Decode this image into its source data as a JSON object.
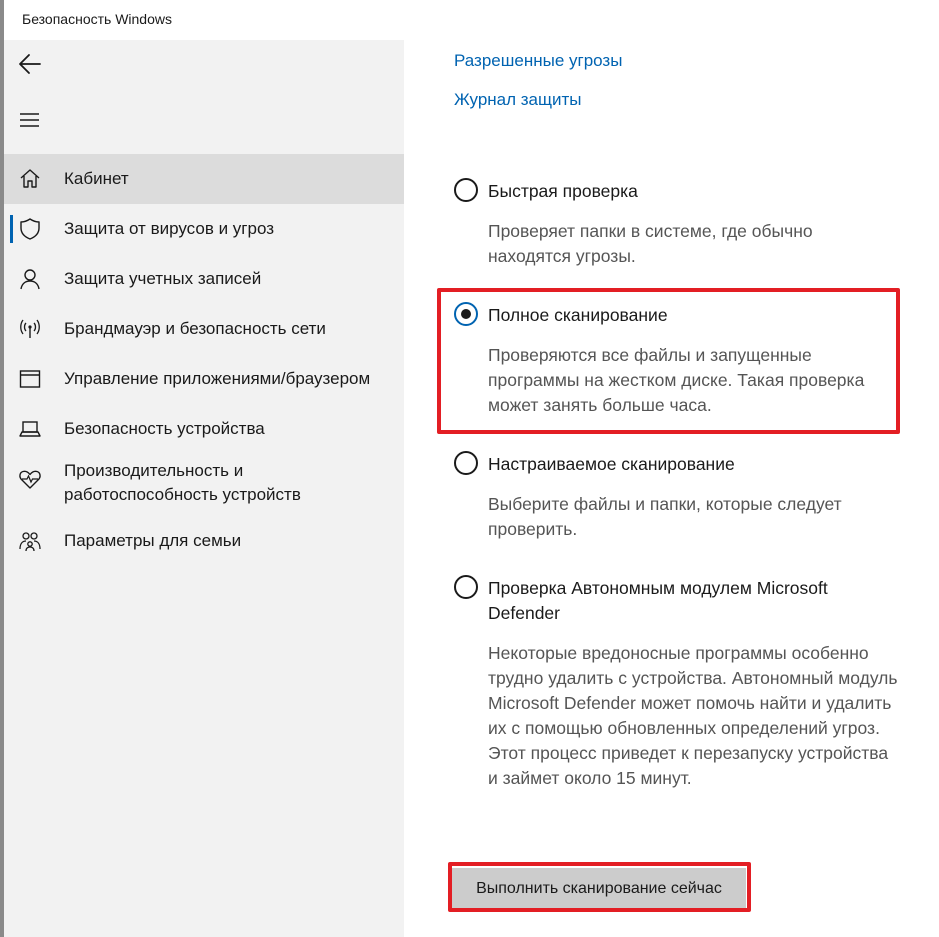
{
  "window": {
    "title": "Безопасность Windows"
  },
  "sidebar": {
    "back_icon": "back-arrow-icon",
    "menu_icon": "hamburger-menu-icon",
    "items": [
      {
        "label": "Кабинет",
        "icon": "home-icon",
        "active": true
      },
      {
        "label": "Защита от вирусов и угроз",
        "icon": "shield-icon",
        "selected_indicator": true
      },
      {
        "label": "Защита учетных записей",
        "icon": "person-icon"
      },
      {
        "label": "Брандмауэр и безопасность сети",
        "icon": "wifi-antenna-icon"
      },
      {
        "label": "Управление приложениями/браузером",
        "icon": "browser-window-icon"
      },
      {
        "label": "Безопасность устройства",
        "icon": "laptop-icon"
      },
      {
        "label": "Производительность и работоспособность устройств",
        "icon": "heart-pulse-icon"
      },
      {
        "label": "Параметры для семьи",
        "icon": "family-icon"
      }
    ]
  },
  "main": {
    "links": [
      {
        "label": "Разрешенные угрозы"
      },
      {
        "label": "Журнал защиты"
      }
    ],
    "options": [
      {
        "title": "Быстрая проверка",
        "description": "Проверяет папки в системе, где обычно находятся угрозы.",
        "checked": false
      },
      {
        "title": "Полное сканирование",
        "description": "Проверяются все файлы и запущенные программы на жестком диске. Такая проверка может занять больше часа.",
        "checked": true
      },
      {
        "title": "Настраиваемое сканирование",
        "description": "Выберите файлы и папки, которые следует проверить.",
        "checked": false
      },
      {
        "title": "Проверка Автономным модулем Microsoft Defender",
        "description": "Некоторые вредоносные программы особенно трудно удалить с устройства. Автономный модуль Microsoft Defender может помочь найти и удалить их с помощью обновленных определений угроз. Этот процесс приведет к перезапуску устройства и займет около 15 минут.",
        "checked": false
      }
    ],
    "scan_button": "Выполнить сканирование сейчас"
  },
  "colors": {
    "accent": "#0063b1",
    "highlight": "#e31e24",
    "sidebar_bg": "#f2f2f2",
    "button_bg": "#cccccc"
  }
}
